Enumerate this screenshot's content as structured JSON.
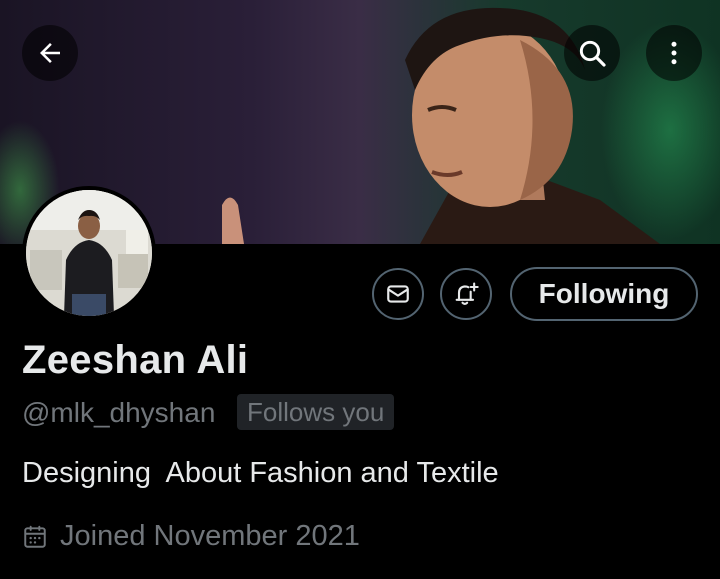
{
  "header": {
    "back_icon": "arrow-left-icon",
    "search_icon": "search-icon",
    "more_icon": "more-vertical-icon"
  },
  "profile": {
    "display_name": "Zeeshan Ali",
    "handle": "@mlk_dhyshan",
    "follows_you_badge": "Follows you",
    "bio": "Designing  About Fashion and Textile",
    "joined": "Joined November 2021"
  },
  "actions": {
    "message_icon": "envelope-icon",
    "notify_icon": "bell-plus-icon",
    "following_label": "Following"
  },
  "colors": {
    "background": "#000000",
    "text_primary": "#e7e9ea",
    "text_secondary": "#71767b",
    "border": "#536471",
    "badge_bg": "#202327"
  }
}
